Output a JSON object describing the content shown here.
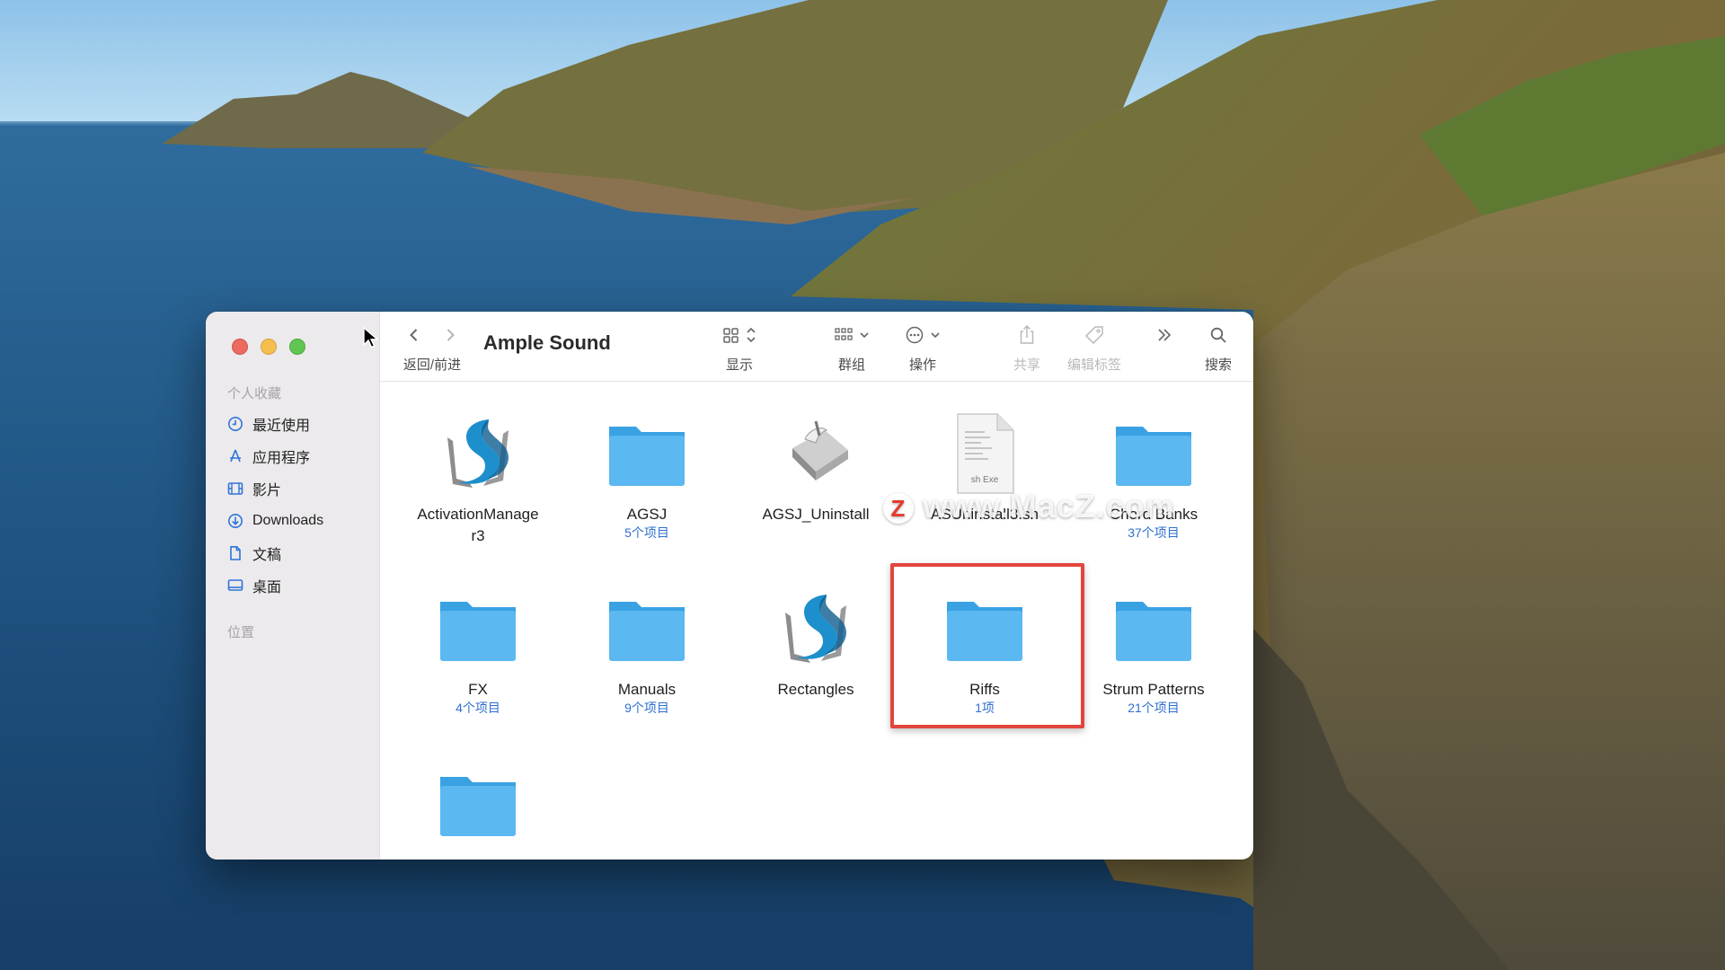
{
  "colors": {
    "folder": "#5bb8f0",
    "folder_dark": "#3aa2e3",
    "highlight": "#e2453c",
    "link": "#2f6fd0"
  },
  "window": {
    "title": "Ample Sound"
  },
  "toolbar": {
    "nav_label": "返回/前进",
    "view_label": "显示",
    "group_label": "群组",
    "action_label": "操作",
    "share_label": "共享",
    "tags_label": "编辑标签",
    "search_label": "搜索"
  },
  "sidebar": {
    "favorites_header": "个人收藏",
    "items": [
      {
        "label": "最近使用",
        "icon": "clock-icon"
      },
      {
        "label": "应用程序",
        "icon": "applications-icon"
      },
      {
        "label": "影片",
        "icon": "film-icon"
      },
      {
        "label": "Downloads",
        "icon": "download-icon"
      },
      {
        "label": "文稿",
        "icon": "document-icon"
      },
      {
        "label": "桌面",
        "icon": "desktop-icon"
      }
    ],
    "locations_header": "位置"
  },
  "files": [
    {
      "name": "ActivationManage\nr3",
      "meta": "",
      "type": "app"
    },
    {
      "name": "AGSJ",
      "meta": "5个项目",
      "type": "folder"
    },
    {
      "name": "AGSJ_Uninstall",
      "meta": "",
      "type": "script"
    },
    {
      "name": "ASUninstall3.sh",
      "meta": "",
      "type": "document"
    },
    {
      "name": "Chord Banks",
      "meta": "37个项目",
      "type": "folder"
    },
    {
      "name": "FX",
      "meta": "4个项目",
      "type": "folder"
    },
    {
      "name": "Manuals",
      "meta": "9个项目",
      "type": "folder"
    },
    {
      "name": "Rectangles",
      "meta": "",
      "type": "app",
      "selected": true
    },
    {
      "name": "Riffs",
      "meta": "1项",
      "type": "folder"
    },
    {
      "name": "Strum Patterns",
      "meta": "21个项目",
      "type": "folder"
    },
    {
      "name": "",
      "meta": "",
      "type": "folder"
    }
  ],
  "document_icon_label": "sh Exe",
  "watermark": {
    "logo": "Z",
    "text": "www.MacZ.com"
  }
}
